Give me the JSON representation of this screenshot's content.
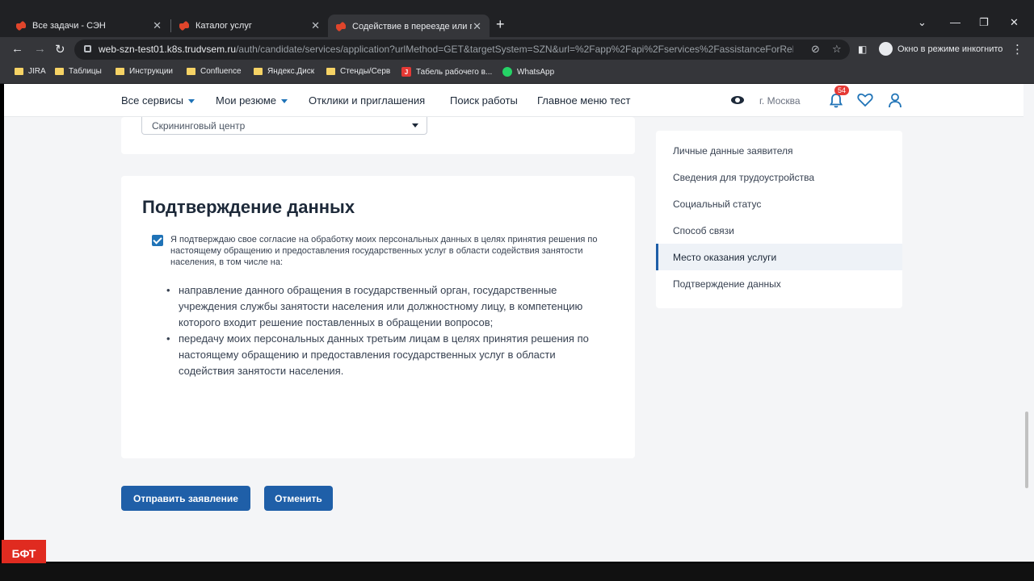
{
  "browser": {
    "tabs": [
      {
        "title": "Все задачи - СЭН"
      },
      {
        "title": "Каталог услуг"
      },
      {
        "title": "Содействие в переезде или пер"
      }
    ],
    "url_host": "web-szn-test01.k8s.trudvsem.ru",
    "url_path": "/auth/candidate/services/application?urlMethod=GET&targetSystem=SZN&url=%2Fapp%2Fapi%2Fservices%2FassistanceForRelocation%...",
    "incognito_label": "Окно в режиме инкогнито",
    "bookmarks": [
      {
        "label": "JIRA"
      },
      {
        "label": "Таблицы"
      },
      {
        "label": "Инструкции"
      },
      {
        "label": "Confluence"
      },
      {
        "label": "Яндекс.Диск"
      },
      {
        "label": "Стенды/Серв"
      },
      {
        "label": "Табель рабочего в..."
      },
      {
        "label": "WhatsApp"
      }
    ]
  },
  "header": {
    "menu": [
      {
        "label": "Все сервисы"
      },
      {
        "label": "Мои резюме"
      },
      {
        "label": "Отклики и приглашения"
      },
      {
        "label": "Поиск работы"
      },
      {
        "label": "Главное меню тест"
      }
    ],
    "city": "г. Москва",
    "notifications": "54"
  },
  "top_card": {
    "select_value": "Скрининговый центр"
  },
  "confirm": {
    "title": "Подтверждение данных",
    "consent": "Я подтверждаю свое согласие на обработку моих персональных данных в целях принятия решения по настоящему обращению и предоставления государственных услуг в области содействия занятости населения, в том числе на:",
    "bullets": [
      "направление данного обращения в государственный орган, государственные учреждения службы занятости населения или должностному лицу, в компетенцию которого входит решение поставленных в обращении вопросов;",
      "передачу моих персональных данных третьим лицам в целях принятия решения по настоящему обращению и предоставления государственных услуг в области содействия занятости населения."
    ]
  },
  "actions": {
    "submit": "Отправить заявление",
    "cancel": "Отменить"
  },
  "sidebar": {
    "items": [
      {
        "label": "Личные данные заявителя"
      },
      {
        "label": "Сведения для трудоустройства"
      },
      {
        "label": "Социальный статус"
      },
      {
        "label": "Способ связи"
      },
      {
        "label": "Место оказания услуги"
      },
      {
        "label": "Подтверждение данных"
      }
    ]
  },
  "logo": "БФТ"
}
